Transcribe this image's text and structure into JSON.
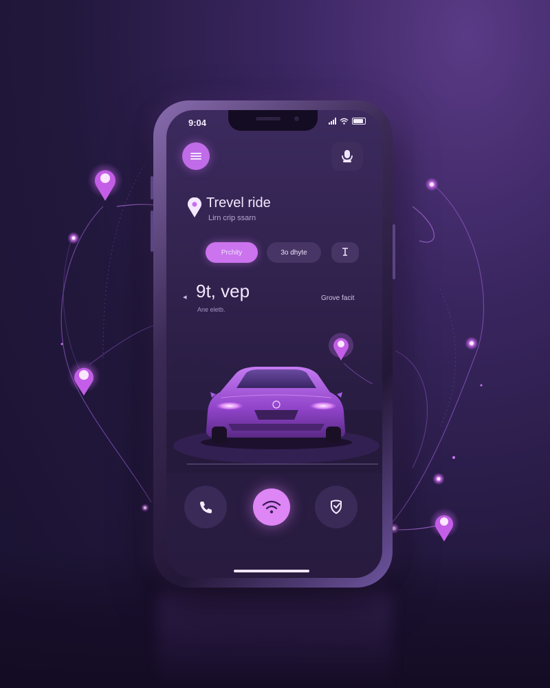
{
  "status_bar": {
    "time": "9:04"
  },
  "header": {
    "menu_icon": "hamburger-menu-icon",
    "mic_icon": "microphone-icon"
  },
  "ride": {
    "title": "Trevel ride",
    "subtitle": "Lirn crip ssarn",
    "pin_icon": "map-pin-icon"
  },
  "chips": {
    "primary": "Prchity",
    "secondary": "3o dhyte",
    "icon": "filter-icon"
  },
  "fare": {
    "amount": "9t, vep",
    "caption": "Ane eletb.",
    "right_label": "Grove facit"
  },
  "actions": {
    "call_icon": "phone-icon",
    "center_icon": "wifi-signal-icon",
    "right_icon": "shield-icon"
  },
  "colors": {
    "accent": "#c86ff0",
    "accent_bright": "#de86f6",
    "background": "#22183d",
    "screen": "#2e2049"
  }
}
